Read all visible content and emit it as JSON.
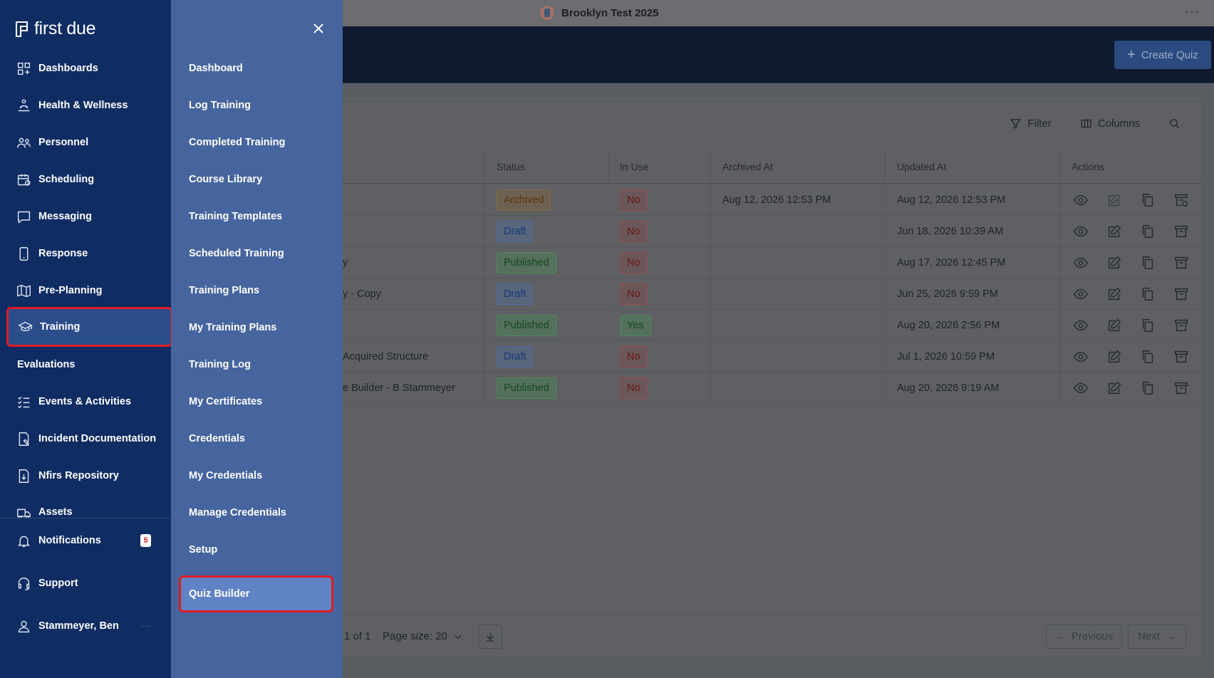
{
  "topbar": {
    "title": "Brooklyn Test 2025",
    "more": "···"
  },
  "header": {
    "create_label": "Create Quiz"
  },
  "toolbar": {
    "filter": "Filter",
    "columns": "Columns"
  },
  "table": {
    "headers": [
      "",
      "Status",
      "In Use",
      "Archived At",
      "Updated At",
      "Actions"
    ],
    "rows": [
      {
        "name": "",
        "status": "Archived",
        "in_use": "No",
        "archived_at": "Aug 12, 2026 12:53 PM",
        "updated_at": "Aug 12, 2026 12:53 PM"
      },
      {
        "name": "",
        "status": "Draft",
        "in_use": "No",
        "archived_at": "",
        "updated_at": "Jun 18, 2026 10:39 AM"
      },
      {
        "name": "y",
        "status": "Published",
        "in_use": "No",
        "archived_at": "",
        "updated_at": "Aug 17, 2026 12:45 PM"
      },
      {
        "name": "y - Copy",
        "status": "Draft",
        "in_use": "No",
        "archived_at": "",
        "updated_at": "Jun 25, 2026 9:59 PM"
      },
      {
        "name": "",
        "status": "Published",
        "in_use": "Yes",
        "archived_at": "",
        "updated_at": "Aug 20, 2026 2:56 PM"
      },
      {
        "name": "Acquired Structure",
        "status": "Draft",
        "in_use": "No",
        "archived_at": "",
        "updated_at": "Jul 1, 2026 10:59 PM"
      },
      {
        "name": "e Builder - B Stammeyer",
        "status": "Published",
        "in_use": "No",
        "archived_at": "",
        "updated_at": "Aug 20, 2026 9:19 AM"
      }
    ]
  },
  "footer": {
    "page_info": "1 of 1",
    "page_size": "Page size: 20",
    "previous": "Previous",
    "next": "Next"
  },
  "sidebar": {
    "brand": "first due",
    "items": [
      {
        "label": "Dashboards",
        "icon": "dashboard-icon"
      },
      {
        "label": "Health & Wellness",
        "icon": "health-icon"
      },
      {
        "label": "Personnel",
        "icon": "people-icon"
      },
      {
        "label": "Scheduling",
        "icon": "calendar-icon"
      },
      {
        "label": "Messaging",
        "icon": "chat-icon"
      },
      {
        "label": "Response",
        "icon": "phone-icon"
      },
      {
        "label": "Pre-Planning",
        "icon": "map-icon"
      },
      {
        "label": "Training",
        "icon": "graduation-cap-icon"
      },
      {
        "label": "Evaluations",
        "icon": ""
      },
      {
        "label": "Events & Activities",
        "icon": "list-icon"
      },
      {
        "label": "Incident Documentation",
        "icon": "document-icon"
      },
      {
        "label": "Nfirs Repository",
        "icon": "file-download-icon"
      },
      {
        "label": "Assets",
        "icon": "truck-icon"
      }
    ],
    "notifications": {
      "label": "Notifications",
      "count": "5"
    },
    "support": "Support",
    "user": "Stammeyer, Ben"
  },
  "submenu": {
    "items": [
      "Dashboard",
      "Log Training",
      "Completed Training",
      "Course Library",
      "Training Templates",
      "Scheduled Training",
      "Training Plans",
      "My Training Plans",
      "Training Log",
      "My Certificates",
      "Credentials",
      "My Credentials",
      "Manage Credentials",
      "Setup",
      "Quiz Builder"
    ],
    "active": "Quiz Builder"
  },
  "colors": {
    "sidebar": "#0f2c63",
    "submenu": "#46659e",
    "highlight": "#e01b24"
  }
}
